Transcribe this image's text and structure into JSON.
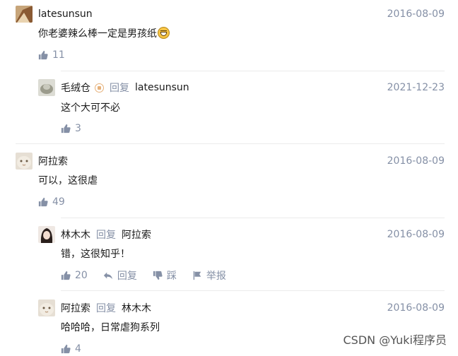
{
  "comments": [
    {
      "author": "latesunsun",
      "date": "2016-08-09",
      "content": "你老婆辣么棒一定是男孩纸",
      "emoji": "grinning-emoji",
      "likes": "11"
    },
    {
      "author": "毛绒仓",
      "reply_word": "回复",
      "reply_to": "latesunsun",
      "date": "2021-12-23",
      "content": "这个大可不必",
      "likes": "3"
    },
    {
      "author": "阿拉索",
      "date": "2016-08-09",
      "content": "可以，这很虐",
      "likes": "49"
    },
    {
      "author": "林木木",
      "reply_word": "回复",
      "reply_to": "阿拉索",
      "date": "2016-08-09",
      "content": "错，这很知乎！",
      "likes": "20",
      "reply_action": "回复",
      "dislike_action": "踩",
      "report_action": "举报"
    },
    {
      "author": "阿拉索",
      "reply_word": "回复",
      "reply_to": "林木木",
      "date": "2016-08-09",
      "content": "哈哈哈，日常虐狗系列",
      "likes": "4"
    }
  ],
  "icons": {
    "like": "thumbs-up-icon",
    "reply": "reply-arrow-icon",
    "dislike": "thumbs-down-icon",
    "report": "flag-icon"
  },
  "colors": {
    "meta_gray": "#8590a6",
    "text": "#1a1a1a",
    "divider": "#ebebeb"
  },
  "watermark": "CSDN @Yuki程序员"
}
